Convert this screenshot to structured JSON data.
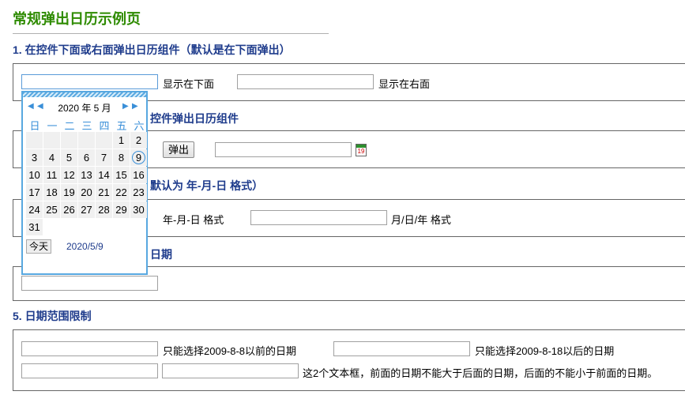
{
  "page": {
    "title": "常规弹出日历示例页"
  },
  "sections": [
    {
      "heading": "1.  在控件下面或右面弹出日历组件（默认是在下面弹出）",
      "labels": [
        "显示在下面",
        "显示在右面"
      ]
    },
    {
      "heading": "2. 点击按钮或图标以后再控件弹出日历组件",
      "visible_heading": "控件弹出日历组件",
      "button": "弹出",
      "icon_number": "19"
    },
    {
      "heading": "3. 设置日期格式（默认为  年-月-日  格式）",
      "visible_heading": "默认为  年-月-日  格式）",
      "labels": [
        "年-月-日 格式",
        "月/日/年 格式"
      ]
    },
    {
      "heading": "4. 在文本框显示带时间的日期",
      "visible_heading": "日期"
    },
    {
      "heading": "5.  日期范围限制",
      "labels": [
        "只能选择2009-8-8以前的日期",
        "只能选择2009-8-18以后的日期",
        "这2个文本框，前面的日期不能大于后面的日期，后面的不能小于前面的日期。"
      ]
    }
  ],
  "calendar": {
    "prev_year": "◀",
    "prev_month": "◀",
    "next_month": "▶",
    "next_year": "▶",
    "year_month": "2020 年 5 月",
    "weekdays": [
      "日",
      "一",
      "二",
      "三",
      "四",
      "五",
      "六"
    ],
    "days": [
      "",
      "",
      "",
      "",
      "",
      "1",
      "2",
      "3",
      "4",
      "5",
      "6",
      "7",
      "8",
      "9",
      "10",
      "11",
      "12",
      "13",
      "14",
      "15",
      "16",
      "17",
      "18",
      "19",
      "20",
      "21",
      "22",
      "23",
      "24",
      "25",
      "26",
      "27",
      "28",
      "29",
      "30",
      "31"
    ],
    "highlighted_day": "9",
    "today_button": "今天",
    "today_date": "2020/5/9"
  },
  "colors": {
    "title": "#2e8b00",
    "heading": "#1f3c8c",
    "calendar_accent": "#3a8fd8"
  }
}
